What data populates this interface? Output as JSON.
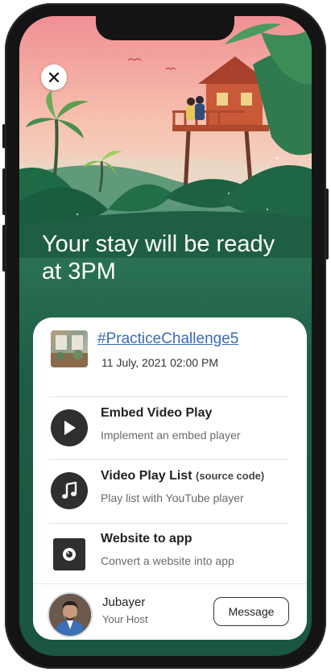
{
  "hero": {
    "headline": "Your stay will be ready at 3PM"
  },
  "post": {
    "tag": "#PracticeChallenge5",
    "date": "11 July, 2021 02:00 PM"
  },
  "items": [
    {
      "title": "Embed Video Play",
      "title_suffix": "",
      "desc": "Implement an embed player",
      "icon": "play-icon"
    },
    {
      "title": "Video Play List",
      "title_suffix": "(source code)",
      "desc": "Play list with YouTube player",
      "icon": "music-note-icon"
    },
    {
      "title": "Website to app",
      "title_suffix": "",
      "desc": "Convert a website into app",
      "icon": "camera-app-icon"
    }
  ],
  "host": {
    "name": "Jubayer",
    "role": "Your Host",
    "message_label": "Message"
  },
  "colors": {
    "card_bg": "#ffffff",
    "green_dark": "#1b5841",
    "link": "#3a6ab8",
    "icon_bg": "#2f2f2f"
  }
}
